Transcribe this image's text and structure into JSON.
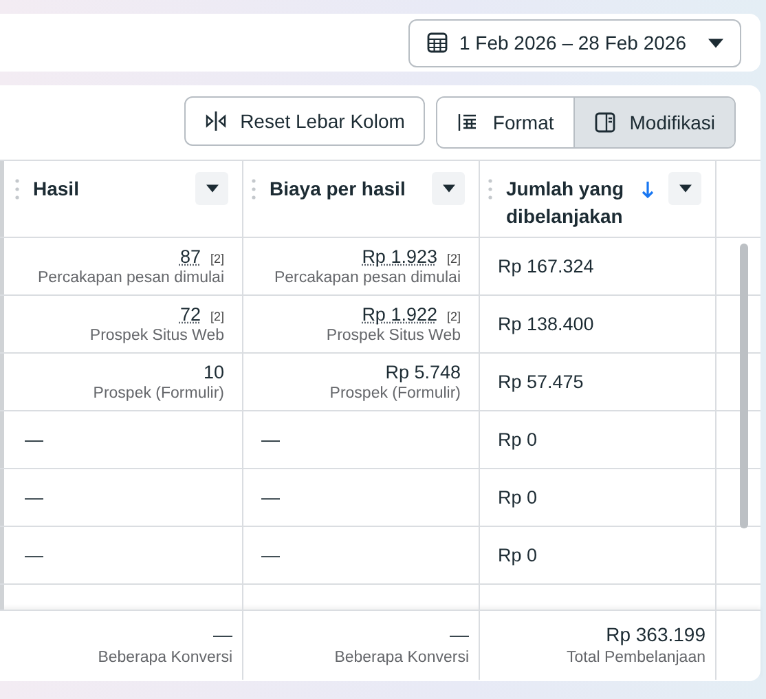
{
  "date_range": {
    "label": "1 Feb 2026 – 28 Feb 2026"
  },
  "toolbar": {
    "reset_button": "Reset Lebar Kolom",
    "view_toggle": [
      {
        "label": "Format",
        "kind": "format",
        "selected": false
      },
      {
        "label": "Modifikasi",
        "kind": "modify",
        "selected": true
      }
    ]
  },
  "table": {
    "columns": [
      {
        "label": "Hasil",
        "sort_descending": false
      },
      {
        "label": "Biaya per hasil",
        "sort_descending": false
      },
      {
        "label": "Jumlah yang dibelanjakan",
        "sort_descending": true
      }
    ],
    "rows": [
      {
        "cells": [
          {
            "value": "87",
            "dotted_underline": true,
            "note": "[2]",
            "caption": "Percakapan pesan dimulai"
          },
          {
            "value": "Rp 1.923",
            "dotted_underline": true,
            "note": "[2]",
            "caption": "Percakapan pesan dimulai"
          },
          {
            "value": "Rp 167.324"
          }
        ]
      },
      {
        "cells": [
          {
            "value": "72",
            "dotted_underline": true,
            "note": "[2]",
            "caption": "Prospek Situs Web"
          },
          {
            "value": "Rp 1.922",
            "dotted_underline": true,
            "note": "[2]",
            "caption": "Prospek Situs Web"
          },
          {
            "value": "Rp 138.400"
          }
        ]
      },
      {
        "cells": [
          {
            "value": "10",
            "dotted_underline": false,
            "caption": "Prospek (Formulir)"
          },
          {
            "value": "Rp 5.748",
            "dotted_underline": false,
            "caption": "Prospek (Formulir)"
          },
          {
            "value": "Rp 57.475"
          }
        ]
      },
      {
        "cells": [
          {
            "value": "—"
          },
          {
            "value": "—"
          },
          {
            "value": "Rp 0"
          }
        ]
      },
      {
        "cells": [
          {
            "value": "—"
          },
          {
            "value": "—"
          },
          {
            "value": "Rp 0"
          }
        ]
      },
      {
        "cells": [
          {
            "value": "—"
          },
          {
            "value": "—"
          },
          {
            "value": "Rp 0"
          }
        ]
      }
    ],
    "totals": [
      {
        "value": "—",
        "caption": "Beberapa Konversi"
      },
      {
        "value": "—",
        "caption": "Beberapa Konversi"
      },
      {
        "value": "Rp 363.199",
        "caption": "Total Pembelanjaan"
      }
    ]
  }
}
